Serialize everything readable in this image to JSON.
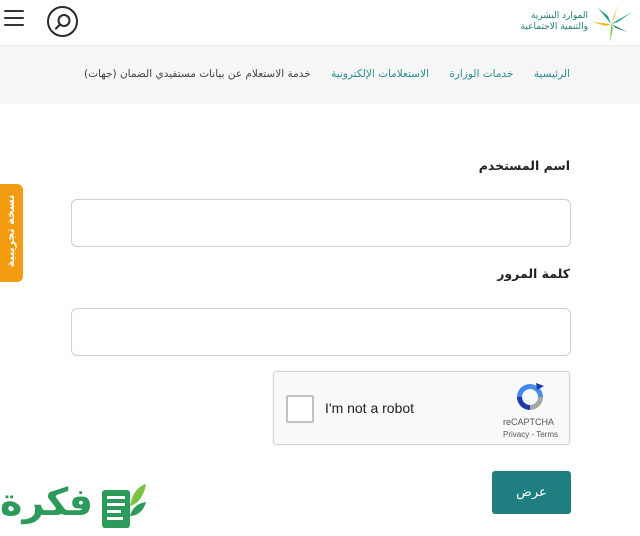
{
  "header": {
    "logo_line1": "الموارد البشرية",
    "logo_line2": "والتنمية الاجتماعية",
    "brand_color": "#1e7c73",
    "menu_icon": "hamburger-icon",
    "search_icon": "search-icon"
  },
  "breadcrumb": {
    "items": [
      "الرئيسية",
      "خدمات الوزارة",
      "الاستعلامات الإلكترونية"
    ],
    "current": "خدمة الاستعلام عن بيانات مستفيدي الضمان (جهات)",
    "link_color": "#2a8c8f"
  },
  "side_tab": {
    "label": "نسخة تجريبية",
    "color": "#f39c12"
  },
  "form": {
    "username_label": "اسم المستخدم",
    "username_value": "",
    "password_label": "كلمة المرور",
    "password_value": "",
    "submit_label": "عرض",
    "submit_color": "#1f7f80"
  },
  "recaptcha": {
    "checkbox_label": "I'm not a robot",
    "brand": "reCAPTCHA",
    "privacy": "Privacy",
    "separator": " - ",
    "terms": "Terms"
  },
  "watermark": {
    "text": "فكرة",
    "color": "#2c9a5b"
  }
}
